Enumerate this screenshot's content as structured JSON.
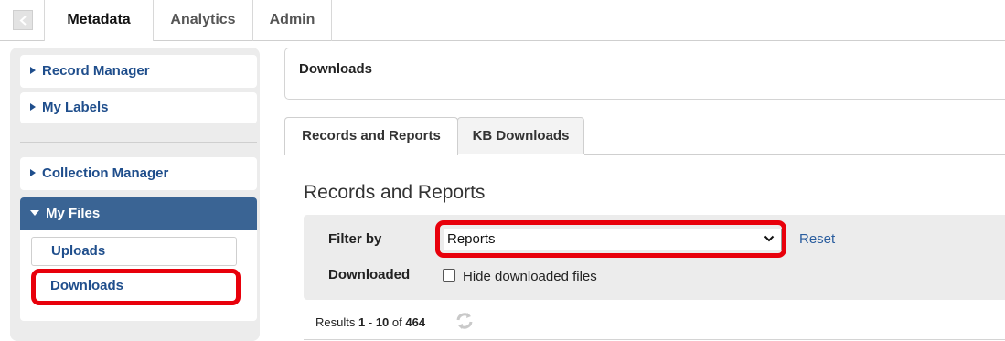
{
  "top_tabs": {
    "metadata": "Metadata",
    "analytics": "Analytics",
    "admin": "Admin"
  },
  "sidebar": {
    "record_manager": "Record Manager",
    "my_labels": "My Labels",
    "collection_manager": "Collection Manager",
    "my_files": "My Files",
    "uploads": "Uploads",
    "downloads": "Downloads"
  },
  "page": {
    "title": "Downloads"
  },
  "tabs": {
    "records_and_reports": "Records and Reports",
    "kb_downloads": "KB Downloads"
  },
  "section": {
    "title": "Records and Reports"
  },
  "filter": {
    "filter_by_label": "Filter by",
    "selected": "Reports",
    "reset": "Reset",
    "downloaded_label": "Downloaded",
    "hide_label": "Hide downloaded files"
  },
  "results": {
    "prefix": "Results",
    "start": "1",
    "sep": "-",
    "end": "10",
    "of": "of",
    "total": "464"
  },
  "colors": {
    "highlight": "#e8000b",
    "link": "#1f4e8c",
    "active_header": "#3a6494"
  }
}
